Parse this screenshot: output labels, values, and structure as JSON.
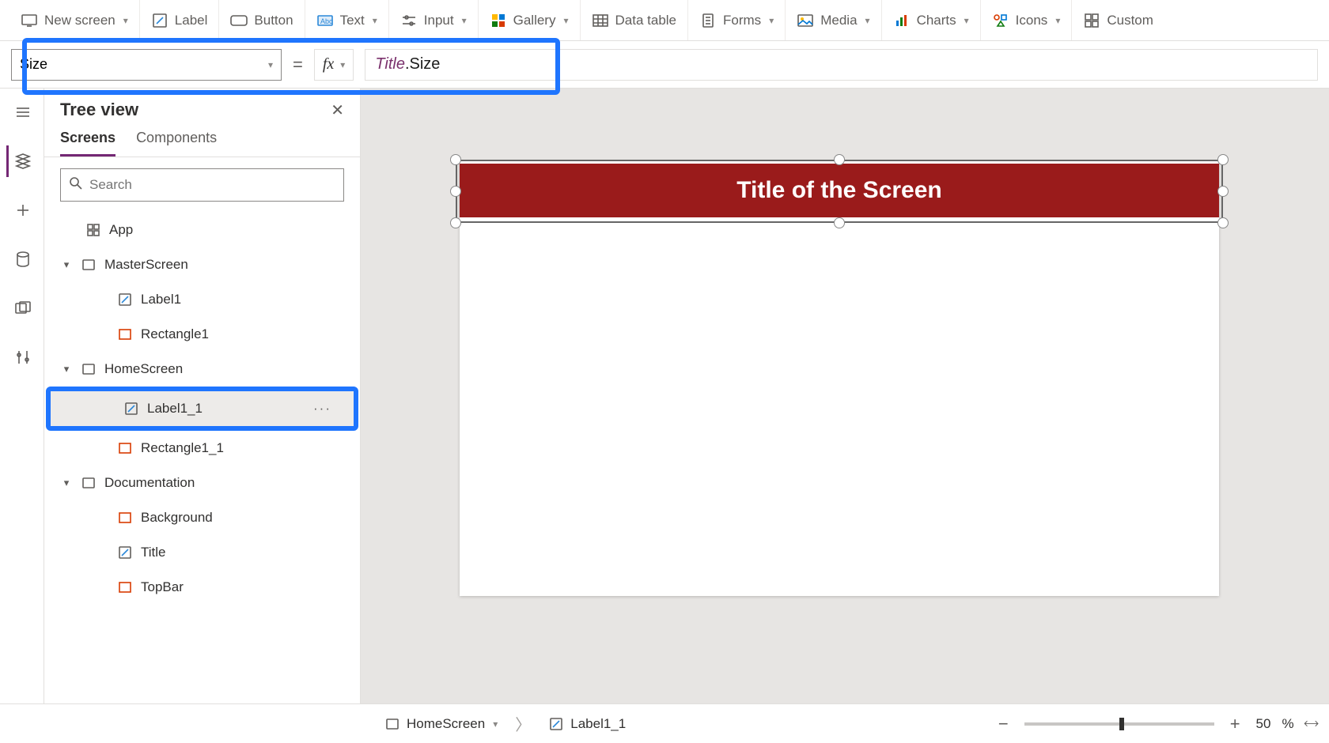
{
  "ribbon": {
    "new_screen": "New screen",
    "label": "Label",
    "button": "Button",
    "text": "Text",
    "input": "Input",
    "gallery": "Gallery",
    "data_table": "Data table",
    "forms": "Forms",
    "media": "Media",
    "charts": "Charts",
    "icons": "Icons",
    "custom": "Custom"
  },
  "formula": {
    "property": "Size",
    "equals": "=",
    "fx": "fx",
    "value_obj": "Title",
    "value_dot": ".",
    "value_prop": "Size"
  },
  "tree": {
    "title": "Tree view",
    "tab_screens": "Screens",
    "tab_components": "Components",
    "search_placeholder": "Search",
    "nodes": {
      "app": "App",
      "master": "MasterScreen",
      "label1": "Label1",
      "rect1": "Rectangle1",
      "home": "HomeScreen",
      "label1_1": "Label1_1",
      "rect1_1": "Rectangle1_1",
      "doc": "Documentation",
      "background": "Background",
      "title_ctrl": "Title",
      "topbar": "TopBar"
    },
    "more": "···"
  },
  "canvas": {
    "title_text": "Title of the Screen"
  },
  "status": {
    "crumb_screen": "HomeScreen",
    "crumb_control": "Label1_1",
    "zoom_value": "50",
    "zoom_pct": "%"
  }
}
